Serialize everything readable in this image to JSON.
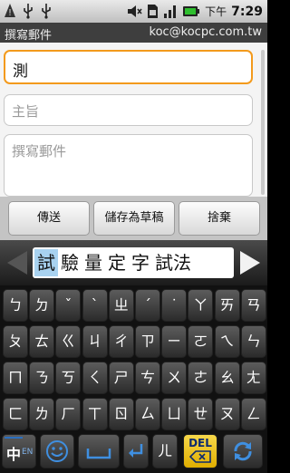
{
  "status_bar": {
    "ampm": "下午",
    "time": "7:29",
    "left_icons": [
      "error-icon",
      "usb-icon",
      "usb-icon"
    ],
    "right_icons": [
      "mute-icon",
      "sim-icon",
      "signal-icon",
      "battery-icon"
    ]
  },
  "title_bar": {
    "title": "撰寫郵件",
    "account": "koc@kocpc.com.tw"
  },
  "compose": {
    "to_value": "測",
    "subject_placeholder": "主旨",
    "body_placeholder": "撰寫郵件"
  },
  "buttons": {
    "send": "傳送",
    "save_draft": "儲存為草稿",
    "discard": "捨棄"
  },
  "candidates": [
    "試",
    "驗",
    "量",
    "定",
    "字",
    "試法"
  ],
  "keyboard": {
    "row1": [
      "ㄅ",
      "ㄉ",
      "ˇ",
      "ˋ",
      "ㄓ",
      "ˊ",
      "˙",
      "ㄚ",
      "ㄞ",
      "ㄢ"
    ],
    "row2": [
      "ㄆ",
      "ㄊ",
      "ㄍ",
      "ㄐ",
      "ㄔ",
      "ㄗ",
      "ㄧ",
      "ㄛ",
      "ㄟ",
      "ㄣ"
    ],
    "row3": [
      "ㄇ",
      "ㄋ",
      "ㄎ",
      "ㄑ",
      "ㄕ",
      "ㄘ",
      "ㄨ",
      "ㄜ",
      "ㄠ",
      "ㄤ"
    ],
    "row4": [
      "ㄈ",
      "ㄌ",
      "ㄏ",
      "ㄒ",
      "ㄖ",
      "ㄙ",
      "ㄩ",
      "ㄝ",
      "ㄡ",
      "ㄥ"
    ],
    "lang_main": "中",
    "lang_sub": "EN",
    "er_key": "ㄦ",
    "del_key": "DEL"
  },
  "colors": {
    "focus_border": "#f39a1c",
    "candidate_highlight": "#a8d2f0",
    "del_key": "#f2c200",
    "lang_key": "#2b6fbf"
  }
}
